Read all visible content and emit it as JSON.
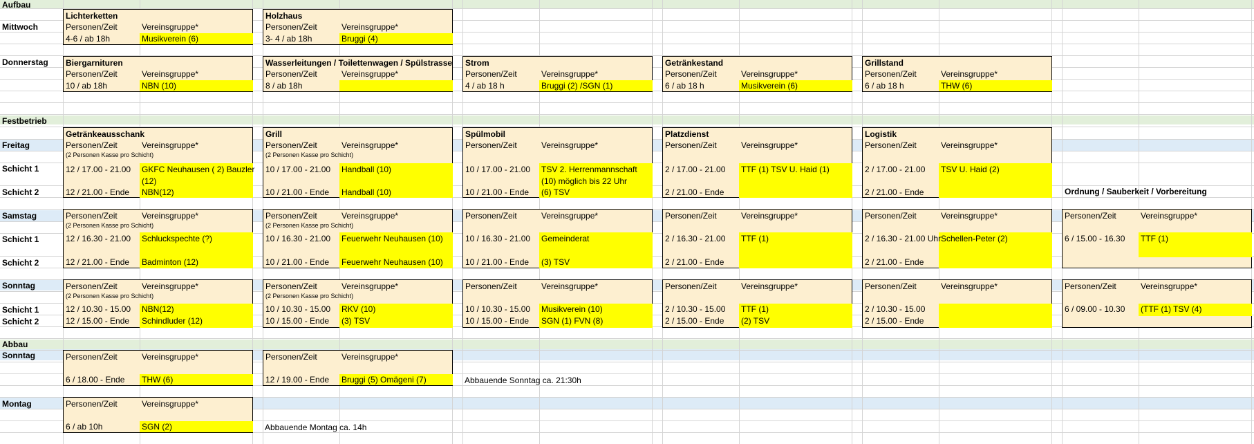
{
  "colors": {
    "band_green": "#e2efda",
    "band_blue": "#ddebf7",
    "box_fill": "#fdefd0",
    "yellow": "#ffff00",
    "grid": "#d4d4d4"
  },
  "sections": {
    "aufbau": "Aufbau",
    "festbetrieb": "Festbetrieb",
    "abbau": "Abbau"
  },
  "days": {
    "mittwoch": "Mittwoch",
    "donnerstag": "Donnerstag",
    "freitag": "Freitag",
    "samstag": "Samstag",
    "sonntag": "Sonntag",
    "montag": "Montag"
  },
  "shifts": {
    "s1": "Schicht 1",
    "s2": "Schicht 2"
  },
  "col_headers": {
    "personen": "Personen/Zeit",
    "verein": "Vereinsgruppe*",
    "kasse": "(2 Personen Kasse pro Schicht)"
  },
  "aufbau": {
    "lichterketten": {
      "title": "Lichterketten",
      "time": "4-6 / ab 18h",
      "group": "Musikverein (6)"
    },
    "holzhaus": {
      "title": "Holzhaus",
      "time": "3- 4 / ab 18h",
      "group": "Bruggi (4)"
    },
    "biergarnituren": {
      "title": "Biergarnituren",
      "time": "10 / ab 18h",
      "group": "NBN (10)"
    },
    "wasser": {
      "title": "Wasserleitungen / Toilettenwagen / Spülstrasse",
      "time": "8 / ab 18h",
      "group": ""
    },
    "strom": {
      "title": "Strom",
      "time": "4 / ab 18 h",
      "group": "Bruggi (2) /SGN (1)"
    },
    "getraenkestand": {
      "title": "Getränkestand",
      "time": "6 / ab 18 h",
      "group": "Musikverein (6)"
    },
    "grillstand": {
      "title": "Grillstand",
      "time": "6 / ab 18 h",
      "group": "THW (6)"
    }
  },
  "fest_titles": {
    "c1": "Getränkeausschank",
    "c2": "Grill",
    "c3": "Spülmobil",
    "c4": "Platzdienst",
    "c5": "Logistik",
    "c6": "Ordnung / Sauberkeit / Vorbereitung"
  },
  "freitag": {
    "c1": {
      "t1": "12 / 17.00 - 21.00",
      "g1": "GKFC Neuhausen ( 2) Bauzler",
      "g1b": "(12)",
      "t2": "12 / 21.00 - Ende",
      "g2": "NBN(12)"
    },
    "c2": {
      "t1": "10 / 17.00 - 21.00",
      "g1": "Handball (10)",
      "t2": "10 / 21.00 - Ende",
      "g2": "Handball (10)"
    },
    "c3": {
      "t1": "10 / 17.00 - 21.00",
      "g1": "TSV 2. Herrenmannschaft",
      "g1b": "(10) möglich bis 22 Uhr",
      "t2": "10 / 21.00 - Ende",
      "g2": "(6) TSV"
    },
    "c4": {
      "t1": "2 / 17.00 - 21.00",
      "g1": "TTF (1) TSV U. Haid (1)",
      "t2": "2 / 21.00 - Ende",
      "g2": ""
    },
    "c5": {
      "t1": "2 / 17.00 - 21.00",
      "g1": "TSV U. Haid (2)",
      "t2": "2 / 21.00 - Ende",
      "g2": ""
    }
  },
  "samstag": {
    "c1": {
      "t1": "12 / 16.30 - 21.00",
      "g1": "Schluckspechte (?)",
      "t2": "12 / 21.00 - Ende",
      "g2": "Badminton (12)"
    },
    "c2": {
      "t1": "10 / 16.30 - 21.00",
      "g1": "Feuerwehr Neuhausen (10)",
      "t2": "10 / 21.00 - Ende",
      "g2": "Feuerwehr Neuhausen (10)"
    },
    "c3": {
      "t1": "10 / 16.30 - 21.00",
      "g1": "Gemeinderat",
      "t2": "10 / 21.00 - Ende",
      "g2": "(3) TSV"
    },
    "c4": {
      "t1": "2 / 16.30 - 21.00",
      "g1": "TTF (1)",
      "t2": "2 / 21.00 - Ende",
      "g2": ""
    },
    "c5": {
      "t1": "2 / 16.30 - 21.00 Uhr",
      "g1": "Schellen-Peter (2)",
      "t2": "2 / 21.00 - Ende",
      "g2": ""
    },
    "c6": {
      "t1": "6 / 15.00 - 16.30",
      "g1": "TTF (1)"
    }
  },
  "sonntag": {
    "c1": {
      "t1": "12 / 10.30 - 15.00",
      "g1": "NBN(12)",
      "t2": "12 / 15.00 - Ende",
      "g2": "Schindluder (12)"
    },
    "c2": {
      "t1": "10 / 10.30 - 15.00",
      "g1": "RKV (10)",
      "t2": "10 / 15.00 - Ende",
      "g2": "(3) TSV"
    },
    "c3": {
      "t1": "10 / 10.30 - 15.00",
      "g1": "Musikverein (10)",
      "t2": "10 / 15.00 - Ende",
      "g2": "SGN (1) FVN (8)"
    },
    "c4": {
      "t1": "2 / 10.30 - 15.00",
      "g1": "TTF (1)",
      "t2": "2 / 15.00 - Ende",
      "g2": "(2) TSV"
    },
    "c5": {
      "t1": "2 / 10.30 - 15.00",
      "g1": "",
      "t2": "2 / 15.00 - Ende",
      "g2": ""
    },
    "c6": {
      "t1": "6 / 09.00 - 10.30",
      "g1": "(TTF (1) TSV (4)"
    }
  },
  "abbau": {
    "so1": {
      "time": "6 / 18.00 - Ende",
      "group": "THW (6)"
    },
    "so2": {
      "time": "12 / 19.00 - Ende",
      "group": "Bruggi (5) Omägeni (7)"
    },
    "so_note": "Abbauende Sonntag ca. 21:30h",
    "mo1": {
      "time": "6 / ab 10h",
      "group": "SGN (2)"
    },
    "mo_note": "Abbauende Montag ca. 14h"
  }
}
